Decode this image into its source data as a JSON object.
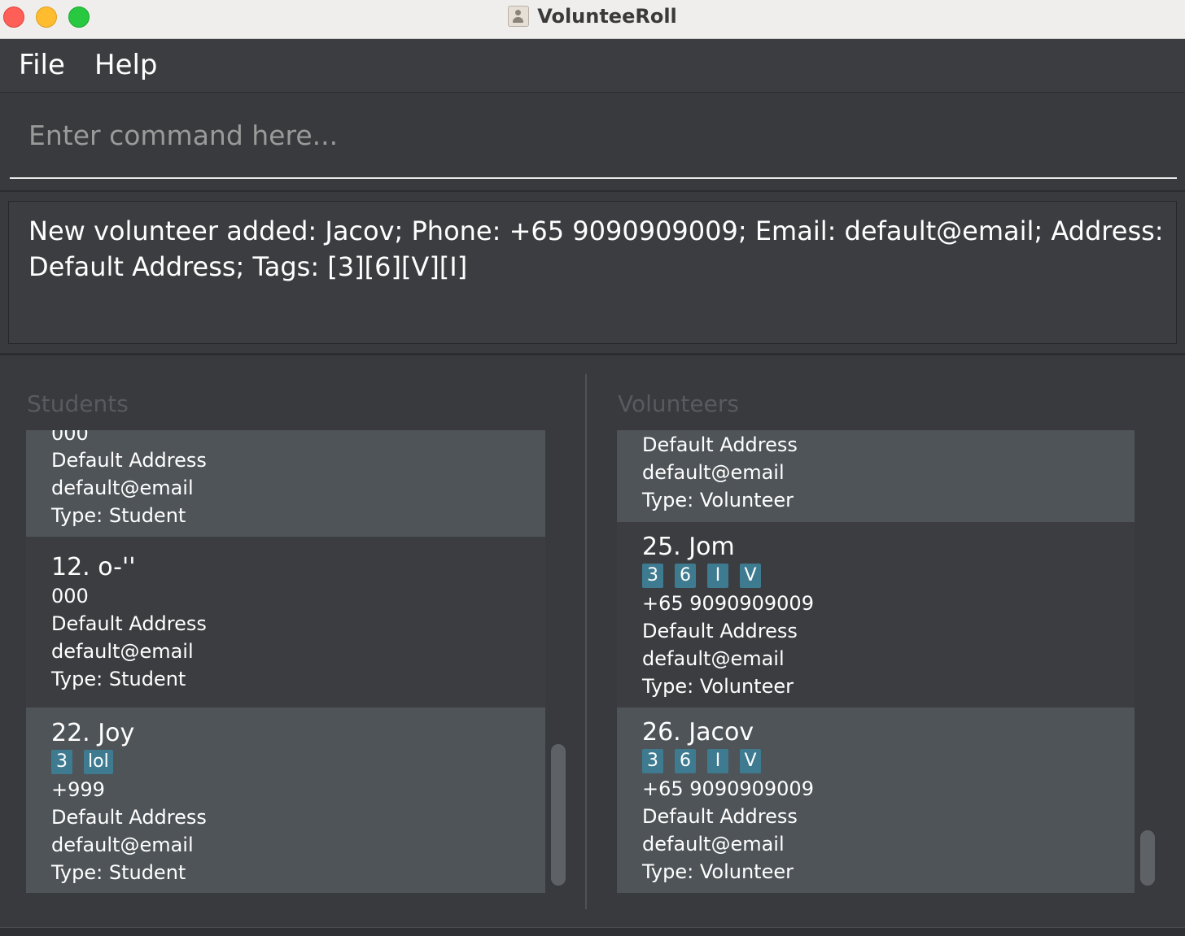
{
  "window": {
    "title": "VolunteeRoll"
  },
  "menu": {
    "file": "File",
    "help": "Help"
  },
  "command": {
    "placeholder": "Enter command here..."
  },
  "result": {
    "text": "New volunteer added: Jacov; Phone: +65 9090909009; Email: default@email; Address: Default Address; Tags: [3][6][V][I]"
  },
  "students": {
    "title": "Students",
    "cards": [
      {
        "name": "",
        "phone": "000",
        "address": "Default Address",
        "email": "default@email",
        "type": "Type: Student",
        "tags": []
      },
      {
        "name": "12. o-''",
        "phone": "000",
        "address": "Default Address",
        "email": "default@email",
        "type": "Type: Student",
        "tags": []
      },
      {
        "name": "22. Joy",
        "phone": "+999",
        "address": "Default Address",
        "email": "default@email",
        "type": "Type: Student",
        "tags": [
          "3",
          "lol"
        ]
      }
    ]
  },
  "volunteers": {
    "title": "Volunteers",
    "cards": [
      {
        "name": "",
        "phone": "",
        "address": "Default Address",
        "email": "default@email",
        "type": "Type: Volunteer",
        "tags": []
      },
      {
        "name": "25. Jom",
        "phone": "+65 9090909009",
        "address": "Default Address",
        "email": "default@email",
        "type": "Type: Volunteer",
        "tags": [
          "3",
          "6",
          "I",
          "V"
        ]
      },
      {
        "name": "26. Jacov",
        "phone": "+65 9090909009",
        "address": "Default Address",
        "email": "default@email",
        "type": "Type: Volunteer",
        "tags": [
          "3",
          "6",
          "I",
          "V"
        ]
      }
    ]
  },
  "colors": {
    "tag": "#3e7b91",
    "card_even": "#4f5458",
    "card_odd": "#3b3d40",
    "background": "#383a3d"
  }
}
